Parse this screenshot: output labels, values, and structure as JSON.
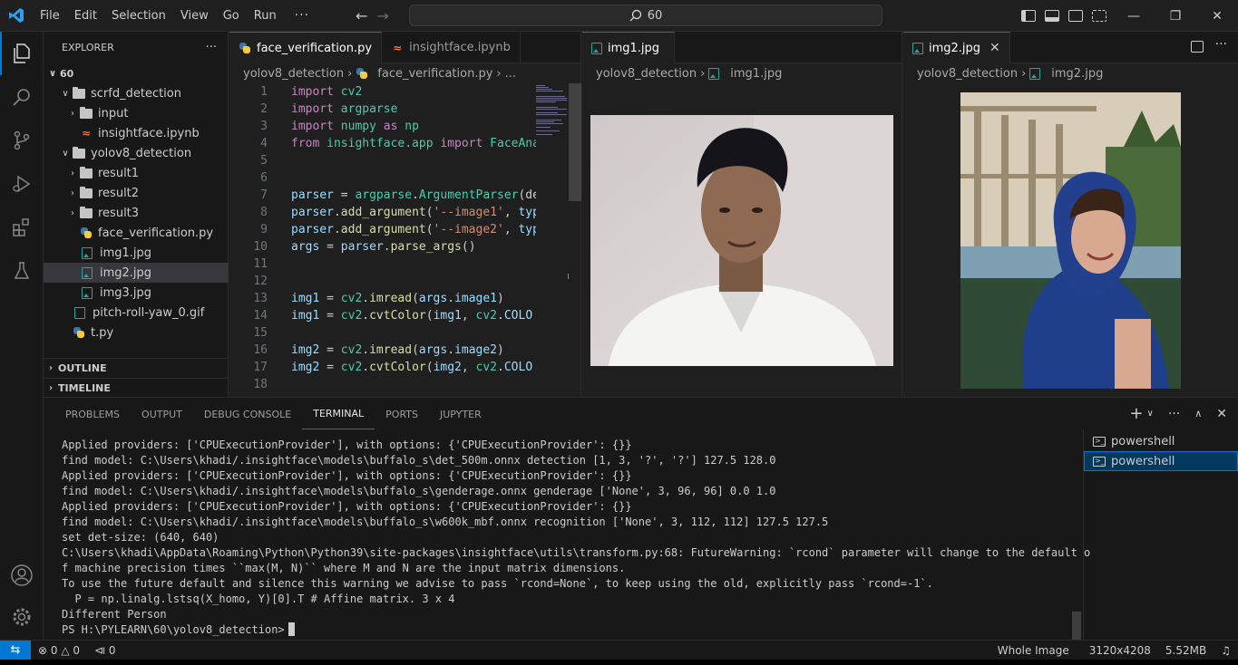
{
  "menu": {
    "items": [
      "File",
      "Edit",
      "Selection",
      "View",
      "Go",
      "Run"
    ],
    "more": "···"
  },
  "command_center": {
    "query": "60"
  },
  "explorer": {
    "title": "EXPLORER",
    "more": "···",
    "root": "60",
    "items": [
      {
        "label": "scrfd_detection"
      },
      {
        "label": "input"
      },
      {
        "label": "insightface.ipynb"
      },
      {
        "label": "yolov8_detection"
      },
      {
        "label": "result1"
      },
      {
        "label": "result2"
      },
      {
        "label": "result3"
      },
      {
        "label": "face_verification.py"
      },
      {
        "label": "img1.jpg"
      },
      {
        "label": "img2.jpg"
      },
      {
        "label": "img3.jpg"
      },
      {
        "label": "pitch-roll-yaw_0.gif"
      },
      {
        "label": "t.py"
      }
    ],
    "outline": "OUTLINE",
    "timeline": "TIMELINE"
  },
  "editor1": {
    "tabs": [
      {
        "label": "face_verification.py"
      },
      {
        "label": "insightface.ipynb"
      }
    ],
    "breadcrumb": {
      "folder": "yolov8_detection",
      "file": "face_verification.py",
      "more": "..."
    },
    "lines": [
      {
        "n": "1",
        "tokens": [
          [
            "kw",
            "import "
          ],
          [
            "nm",
            "cv2"
          ]
        ]
      },
      {
        "n": "2",
        "tokens": [
          [
            "kw",
            "import "
          ],
          [
            "nm",
            "argparse"
          ]
        ]
      },
      {
        "n": "3",
        "tokens": [
          [
            "kw",
            "import "
          ],
          [
            "nm",
            "numpy "
          ],
          [
            "kw",
            "as "
          ],
          [
            "nm",
            "np"
          ]
        ]
      },
      {
        "n": "4",
        "tokens": [
          [
            "kw",
            "from "
          ],
          [
            "nm",
            "insightface.app "
          ],
          [
            "kw",
            "import "
          ],
          [
            "nm",
            "FaceAna"
          ]
        ]
      },
      {
        "n": "5",
        "tokens": []
      },
      {
        "n": "6",
        "tokens": []
      },
      {
        "n": "7",
        "tokens": [
          [
            "vr",
            "parser "
          ],
          [
            "pl",
            "= "
          ],
          [
            "nm",
            "argparse"
          ],
          [
            "pl",
            "."
          ],
          [
            "nm",
            "ArgumentParser"
          ],
          [
            "pl",
            "(de"
          ]
        ]
      },
      {
        "n": "8",
        "tokens": [
          [
            "vr",
            "parser"
          ],
          [
            "pl",
            "."
          ],
          [
            "fn",
            "add_argument"
          ],
          [
            "pl",
            "("
          ],
          [
            "st",
            "'--image1'"
          ],
          [
            "pl",
            ", "
          ],
          [
            "vr",
            "typ"
          ]
        ]
      },
      {
        "n": "9",
        "tokens": [
          [
            "vr",
            "parser"
          ],
          [
            "pl",
            "."
          ],
          [
            "fn",
            "add_argument"
          ],
          [
            "pl",
            "("
          ],
          [
            "st",
            "'--image2'"
          ],
          [
            "pl",
            ", "
          ],
          [
            "vr",
            "typ"
          ]
        ]
      },
      {
        "n": "10",
        "tokens": [
          [
            "vr",
            "args "
          ],
          [
            "pl",
            "= "
          ],
          [
            "vr",
            "parser"
          ],
          [
            "pl",
            "."
          ],
          [
            "fn",
            "parse_args"
          ],
          [
            "pl",
            "()"
          ]
        ]
      },
      {
        "n": "11",
        "tokens": []
      },
      {
        "n": "12",
        "tokens": []
      },
      {
        "n": "13",
        "tokens": [
          [
            "vr",
            "img1 "
          ],
          [
            "pl",
            "= "
          ],
          [
            "nm",
            "cv2"
          ],
          [
            "pl",
            "."
          ],
          [
            "fn",
            "imread"
          ],
          [
            "pl",
            "("
          ],
          [
            "vr",
            "args"
          ],
          [
            "pl",
            "."
          ],
          [
            "vr",
            "image1"
          ],
          [
            "pl",
            ")"
          ]
        ]
      },
      {
        "n": "14",
        "tokens": [
          [
            "vr",
            "img1 "
          ],
          [
            "pl",
            "= "
          ],
          [
            "nm",
            "cv2"
          ],
          [
            "pl",
            "."
          ],
          [
            "fn",
            "cvtColor"
          ],
          [
            "pl",
            "("
          ],
          [
            "vr",
            "img1"
          ],
          [
            "pl",
            ", "
          ],
          [
            "nm",
            "cv2"
          ],
          [
            "pl",
            "."
          ],
          [
            "vr",
            "COLO"
          ]
        ]
      },
      {
        "n": "15",
        "tokens": []
      },
      {
        "n": "16",
        "tokens": [
          [
            "vr",
            "img2 "
          ],
          [
            "pl",
            "= "
          ],
          [
            "nm",
            "cv2"
          ],
          [
            "pl",
            "."
          ],
          [
            "fn",
            "imread"
          ],
          [
            "pl",
            "("
          ],
          [
            "vr",
            "args"
          ],
          [
            "pl",
            "."
          ],
          [
            "vr",
            "image2"
          ],
          [
            "pl",
            ")"
          ]
        ]
      },
      {
        "n": "17",
        "tokens": [
          [
            "vr",
            "img2 "
          ],
          [
            "pl",
            "= "
          ],
          [
            "nm",
            "cv2"
          ],
          [
            "pl",
            "."
          ],
          [
            "fn",
            "cvtColor"
          ],
          [
            "pl",
            "("
          ],
          [
            "vr",
            "img2"
          ],
          [
            "pl",
            ", "
          ],
          [
            "nm",
            "cv2"
          ],
          [
            "pl",
            "."
          ],
          [
            "vr",
            "COLO"
          ]
        ]
      },
      {
        "n": "18",
        "tokens": []
      }
    ]
  },
  "editor2": {
    "tab": "img1.jpg",
    "breadcrumb": {
      "folder": "yolov8_detection",
      "file": "img1.jpg"
    }
  },
  "editor3": {
    "tab": "img2.jpg",
    "breadcrumb": {
      "folder": "yolov8_detection",
      "file": "img2.jpg"
    }
  },
  "panel": {
    "tabs": [
      "PROBLEMS",
      "OUTPUT",
      "DEBUG CONSOLE",
      "TERMINAL",
      "PORTS",
      "JUPYTER"
    ],
    "active_tab": "TERMINAL",
    "terminal_lines": [
      "Applied providers: ['CPUExecutionProvider'], with options: {'CPUExecutionProvider': {}}",
      "find model: C:\\Users\\khadi/.insightface\\models\\buffalo_s\\det_500m.onnx detection [1, 3, '?', '?'] 127.5 128.0",
      "Applied providers: ['CPUExecutionProvider'], with options: {'CPUExecutionProvider': {}}",
      "find model: C:\\Users\\khadi/.insightface\\models\\buffalo_s\\genderage.onnx genderage ['None', 3, 96, 96] 0.0 1.0",
      "Applied providers: ['CPUExecutionProvider'], with options: {'CPUExecutionProvider': {}}",
      "find model: C:\\Users\\khadi/.insightface\\models\\buffalo_s\\w600k_mbf.onnx recognition ['None', 3, 112, 112] 127.5 127.5",
      "set det-size: (640, 640)",
      "C:\\Users\\khadi\\AppData\\Roaming\\Python\\Python39\\site-packages\\insightface\\utils\\transform.py:68: FutureWarning: `rcond` parameter will change to the default o",
      "f machine precision times ``max(M, N)`` where M and N are the input matrix dimensions.",
      "To use the future default and silence this warning we advise to pass `rcond=None`, to keep using the old, explicitly pass `rcond=-1`.",
      "  P = np.linalg.lstsq(X_homo, Y)[0].T # Affine matrix. 3 x 4",
      "Different Person"
    ],
    "prompt": "PS H:\\PYLEARN\\60\\yolov8_detection>",
    "terminals": [
      "powershell",
      "powershell"
    ]
  },
  "status": {
    "errors": "0",
    "warnings": "0",
    "ports": "0",
    "image_mode": "Whole Image",
    "dimensions": "3120x4208",
    "size": "5.52MB"
  },
  "colors": {
    "accent": "#0078d4",
    "background": "#1f1f1f",
    "sidebar": "#181818"
  }
}
